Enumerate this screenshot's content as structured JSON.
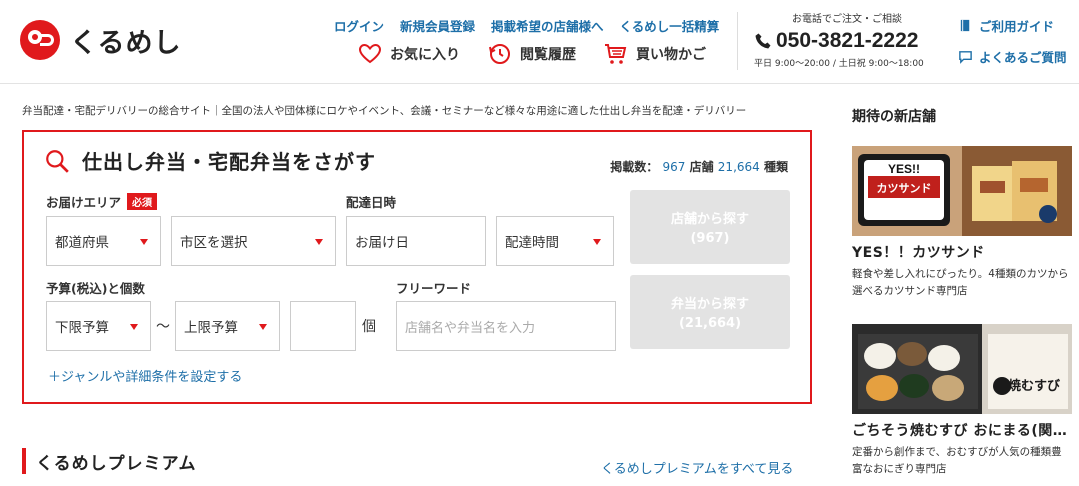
{
  "header": {
    "logo_text": "くるめし",
    "top_links": [
      "ログイン",
      "新規会員登録",
      "掲載希望の店舗様へ",
      "くるめし一括精算"
    ],
    "nav": {
      "favorites": "お気に入り",
      "history": "閲覧履歴",
      "cart": "買い物かご"
    },
    "phone": {
      "label": "お電話でご注文・ご相談",
      "number": "050-3821-2222",
      "hours": "平日 9:00〜20:00 / 土日祝 9:00〜18:00"
    },
    "help": {
      "guide": "ご利用ガイド",
      "faq": "よくあるご質問"
    }
  },
  "tagline": "弁当配達・宅配デリバリーの総合サイト｜全国の法人や団体様にロケやイベント、会議・セミナーなど様々な用途に適した仕出し弁当を配達・デリバリー",
  "search": {
    "title": "仕出し弁当・宅配弁当をさがす",
    "count_prefix": "掲載数：",
    "store_count": "967",
    "store_unit": "店舗",
    "item_count": "21,664",
    "item_unit": "種類",
    "area_label": "お届けエリア",
    "required_badge": "必須",
    "prefecture": "都道府県",
    "city": "市区を選択",
    "datetime_label": "配達日時",
    "date": "お届け日",
    "time": "配達時間",
    "budget_label": "予算(税込)と個数",
    "budget_min": "下限予算",
    "tilde": "〜",
    "budget_max": "上限予算",
    "quantity_unit": "個",
    "freeword_label": "フリーワード",
    "freeword_placeholder": "店舗名や弁当名を入力",
    "btn_store": "店舗から探す",
    "btn_store_count": "(967)",
    "btn_bento": "弁当から探す",
    "btn_bento_count": "(21,664)",
    "genre_link": "＋ジャンルや詳細条件を設定する"
  },
  "premium": {
    "title": "くるめしプレミアム",
    "see_all": "くるめしプレミアムをすべて見る"
  },
  "sidebar": {
    "heading": "期待の新店舗",
    "shops": [
      {
        "name": "YES！！カツサンド",
        "desc": "軽食や差し入れにぴったり。4種類のカツから選べるカツサンド専門店",
        "img_text": "YES!! カツサンド"
      },
      {
        "name": "ごちそう焼むすび おにまる(関…",
        "desc": "定番から創作まで、おむすびが人気の種類豊富なおにぎり専門店",
        "img_text": "焼むすび"
      }
    ]
  },
  "colors": {
    "brand_red": "#e0191c",
    "link_blue": "#1e6fa8"
  }
}
